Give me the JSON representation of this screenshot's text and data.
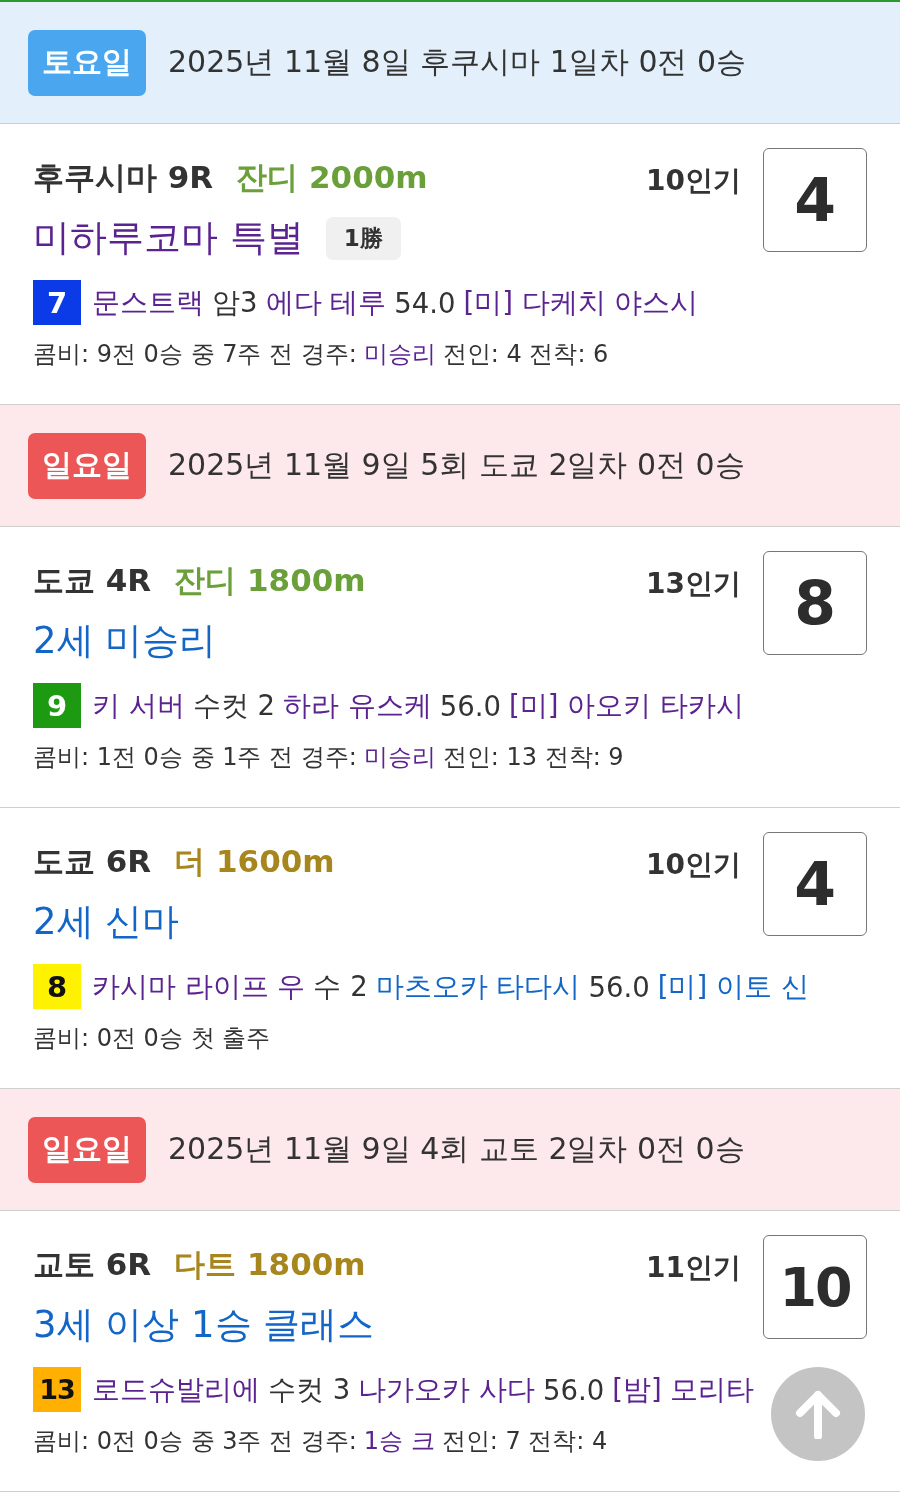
{
  "days": [
    {
      "weekday": "토요일",
      "kind": "saturday",
      "date_text": "2025년 11월 8일 후쿠시마 1일차 0전 0승",
      "races": [
        {
          "venue": "후쿠시마 9R",
          "course": {
            "label": "잔디 2000m",
            "kind": "turf"
          },
          "popularity": "10인기",
          "finish": "4",
          "race_name": {
            "label": "미하루코마 특별",
            "visited": true
          },
          "grade": "1勝",
          "entry": {
            "number": "7",
            "color": "#0a3be6",
            "horse": {
              "label": "문스트랙",
              "visited": true
            },
            "sex_age": "암3",
            "jockey": {
              "label": "에다 테루",
              "visited": true
            },
            "weight": "54.0",
            "trainer": {
              "label": "[미] 다케치 야스시",
              "visited": true
            }
          },
          "combi": {
            "text": "콤비: 9전 0승 중 7주 전 경주:",
            "last_race": {
              "label": "미승리",
              "visited": true
            },
            "result": "전인: 4 전착: 6"
          }
        }
      ]
    },
    {
      "weekday": "일요일",
      "kind": "sunday",
      "date_text": "2025년 11월 9일 5회 도쿄 2일차 0전 0승",
      "races": [
        {
          "venue": "도쿄 4R",
          "course": {
            "label": "잔디 1800m",
            "kind": "turf"
          },
          "popularity": "13인기",
          "finish": "8",
          "race_name": {
            "label": "2세 미승리",
            "visited": false
          },
          "entry": {
            "number": "9",
            "color": "#1e9912",
            "horse": {
              "label": "키 서버",
              "visited": true
            },
            "sex_age": "수컷 2",
            "jockey": {
              "label": "하라 유스케",
              "visited": true
            },
            "weight": "56.0",
            "trainer": {
              "label": "[미] 아오키 타카시",
              "visited": true
            }
          },
          "combi": {
            "text": "콤비: 1전 0승 중 1주 전 경주:",
            "last_race": {
              "label": "미승리",
              "visited": true
            },
            "result": "전인: 13 전착: 9"
          }
        },
        {
          "venue": "도쿄 6R",
          "course": {
            "label": "더 1600m",
            "kind": "dirt"
          },
          "popularity": "10인기",
          "finish": "4",
          "race_name": {
            "label": "2세 신마",
            "visited": false
          },
          "entry": {
            "number": "8",
            "color": "#fff200",
            "horse": {
              "label": "카시마 라이프 우",
              "visited": true
            },
            "sex_age": "수 2",
            "jockey": {
              "label": "마츠오카 타다시",
              "visited": false
            },
            "weight": "56.0",
            "trainer": {
              "label": "[미] 이토 신",
              "visited": false
            }
          },
          "combi": {
            "text": "콤비: 0전 0승 첫 출주"
          }
        }
      ]
    },
    {
      "weekday": "일요일",
      "kind": "sunday",
      "date_text": "2025년 11월 9일 4회 교토 2일차 0전 0승",
      "races": [
        {
          "venue": "교토 6R",
          "course": {
            "label": "다트 1800m",
            "kind": "dirt"
          },
          "popularity": "11인기",
          "finish": "10",
          "race_name": {
            "label": "3세 이상 1승 클래스",
            "visited": false
          },
          "entry": {
            "number": "13",
            "color": "#ffb000",
            "horse": {
              "label": "로드슈발리에",
              "visited": true
            },
            "sex_age": "수컷 3",
            "jockey": {
              "label": "나가오카 사다",
              "visited": true
            },
            "weight": "56.0",
            "trainer": {
              "label": "[밤] 모리타",
              "visited": true
            }
          },
          "combi": {
            "text": "콤비: 0전 0승 중 3주 전 경주:",
            "last_race": {
              "label": "1승 크",
              "visited": true
            },
            "result": "전인: 7 전착: 4"
          }
        }
      ]
    }
  ],
  "scroll_top_button": true
}
